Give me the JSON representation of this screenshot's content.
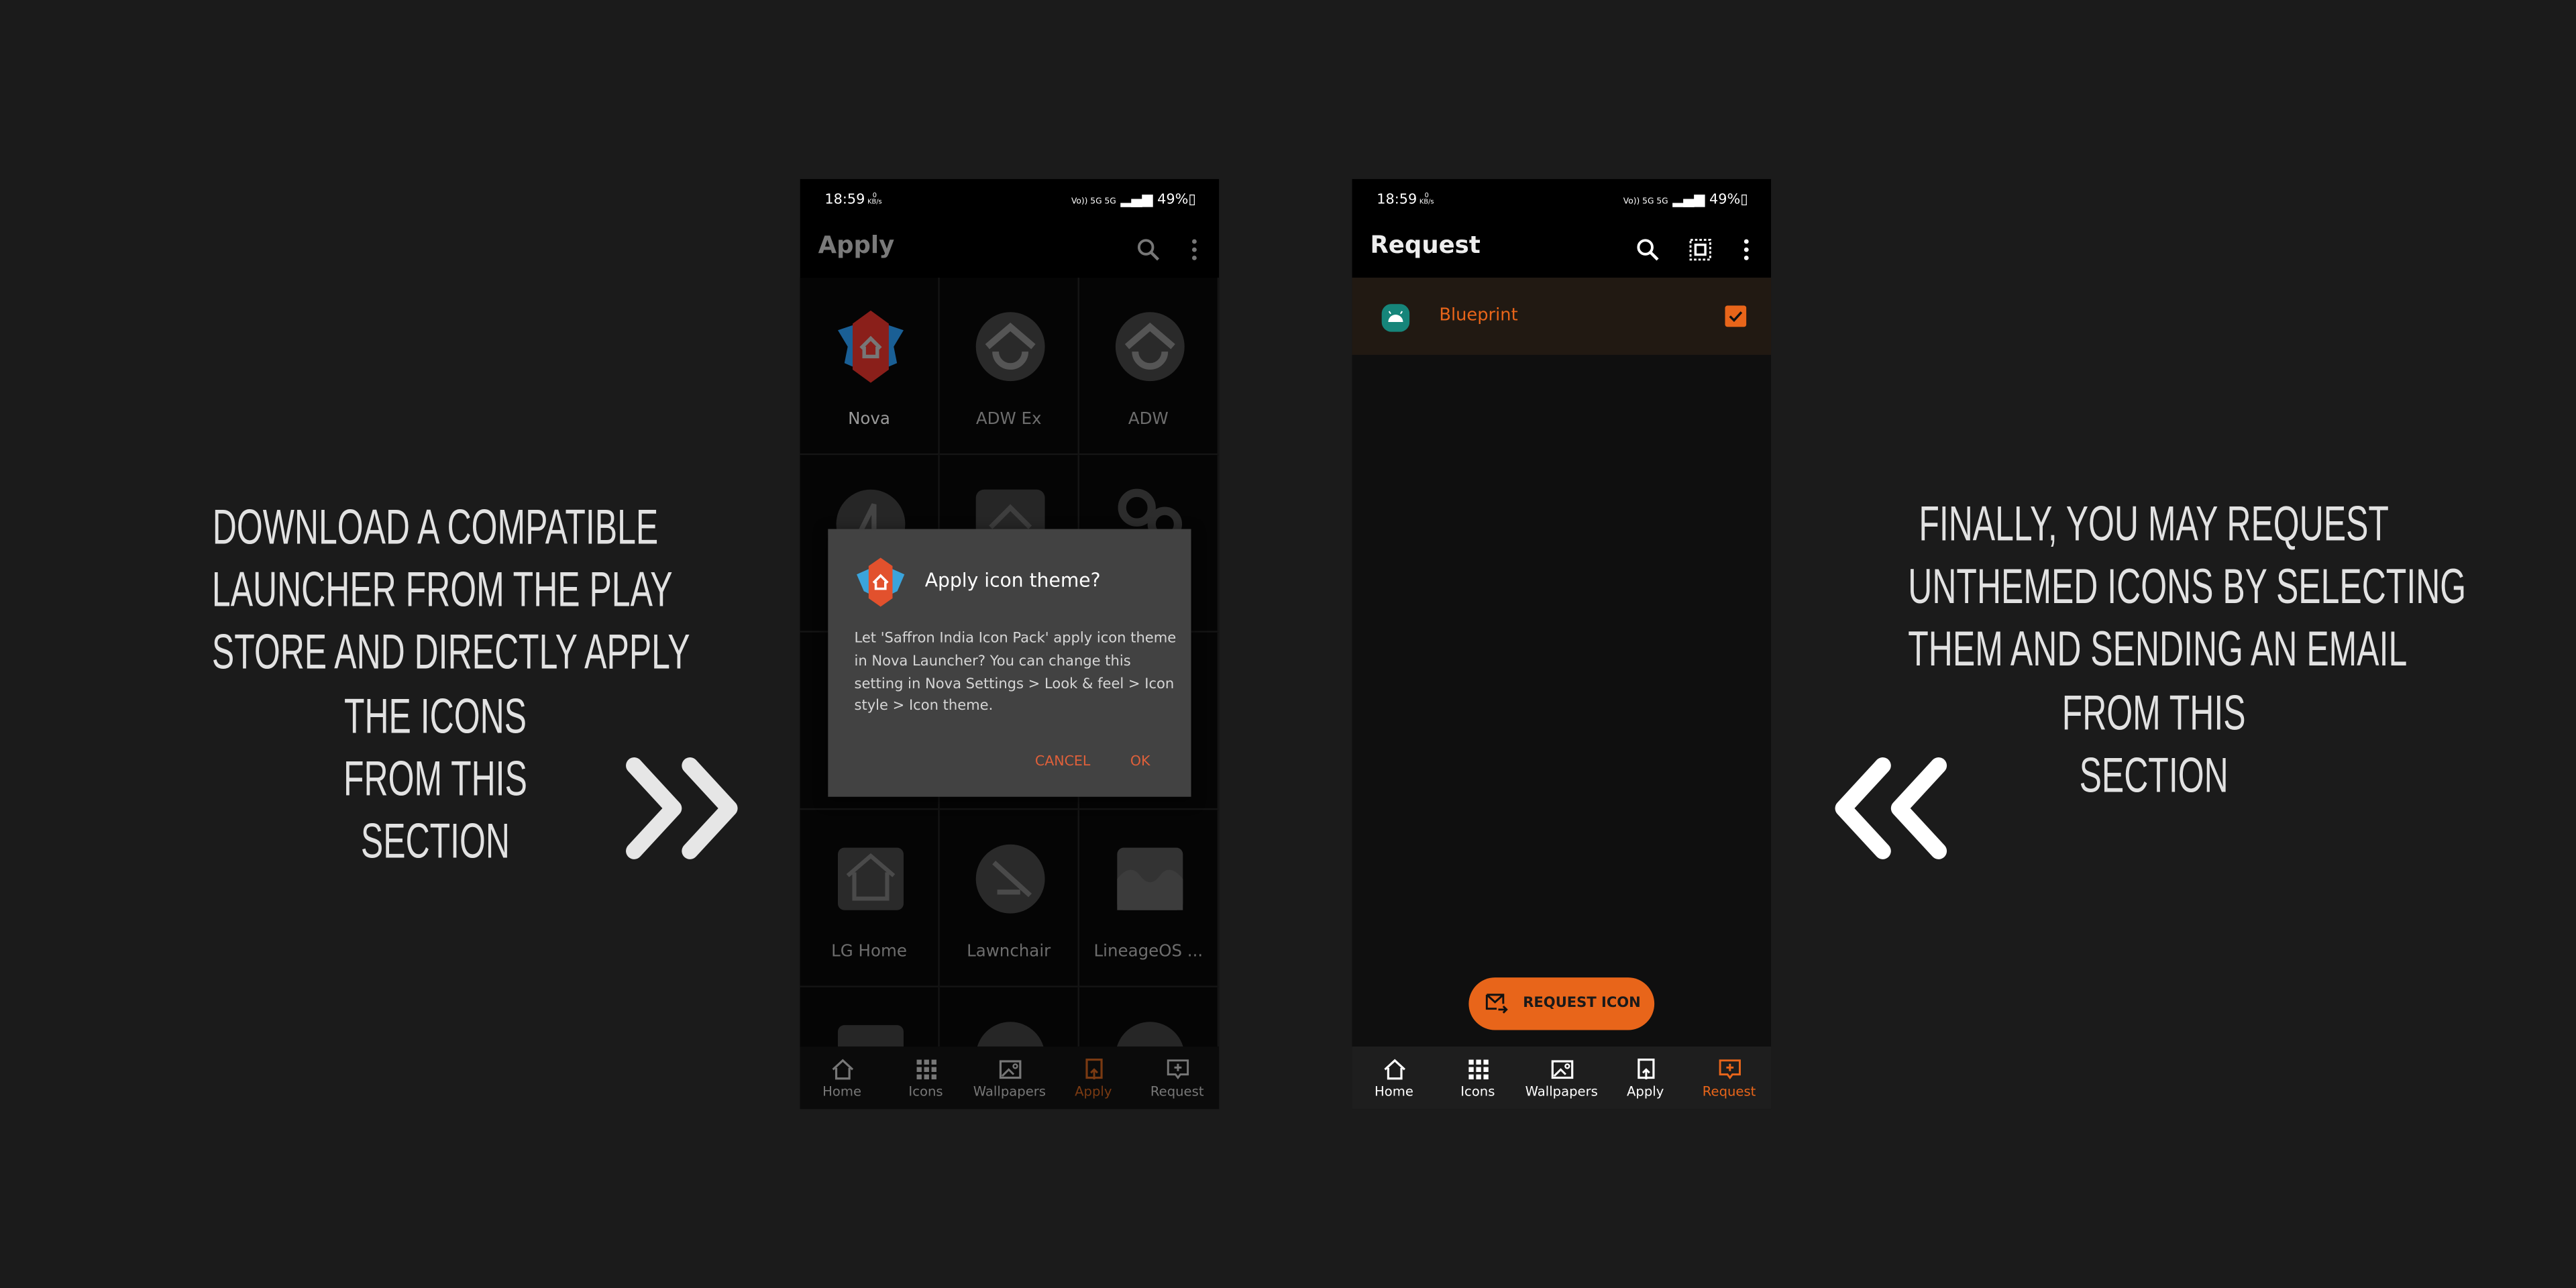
{
  "left_caption": {
    "lines": [
      "DOWNLOAD A COMPATIBLE",
      "LAUNCHER FROM THE PLAY",
      "STORE AND DIRECTLY APPLY",
      "THE ICONS",
      "FROM THIS",
      "SECTION"
    ]
  },
  "right_caption": {
    "lines": [
      "FINALLY, YOU MAY REQUEST",
      "UNTHEMED ICONS BY SELECTING",
      "THEM AND SENDING AN EMAIL",
      "FROM THIS",
      "SECTION"
    ]
  },
  "status_bar": {
    "time": "18:59",
    "net_speed_value": "0",
    "net_speed_unit": "KB/s",
    "network": "Vo)) 5G 5G",
    "battery": "49%"
  },
  "apply_screen": {
    "title": "Apply",
    "launchers": [
      {
        "label": "Nova"
      },
      {
        "label": "ADW Ex"
      },
      {
        "label": "ADW"
      },
      {
        "label": ""
      },
      {
        "label": ""
      },
      {
        "label": ""
      },
      {
        "label": ""
      },
      {
        "label": ""
      },
      {
        "label": ""
      },
      {
        "label": "LG Home"
      },
      {
        "label": "Lawnchair"
      },
      {
        "label": "LineageOS ..."
      }
    ],
    "dialog": {
      "title": "Apply icon theme?",
      "body": "Let 'Saffron India Icon Pack' apply icon theme in Nova Launcher? You can change this setting in Nova Settings > Look & feel > Icon style > Icon theme.",
      "cancel": "CANCEL",
      "ok": "OK"
    },
    "active_tab": "Apply"
  },
  "request_screen": {
    "title": "Request",
    "items": [
      {
        "name": "Blueprint",
        "checked": true
      }
    ],
    "request_button": "REQUEST ICON",
    "active_tab": "Request"
  },
  "nav_tabs": [
    "Home",
    "Icons",
    "Wallpapers",
    "Apply",
    "Request"
  ],
  "colors": {
    "background": "#1b1b1b",
    "accent": "#e8651a",
    "dialog_bg": "#424242",
    "dialog_button": "#e0603a",
    "selected_row_bg": "#211912"
  }
}
